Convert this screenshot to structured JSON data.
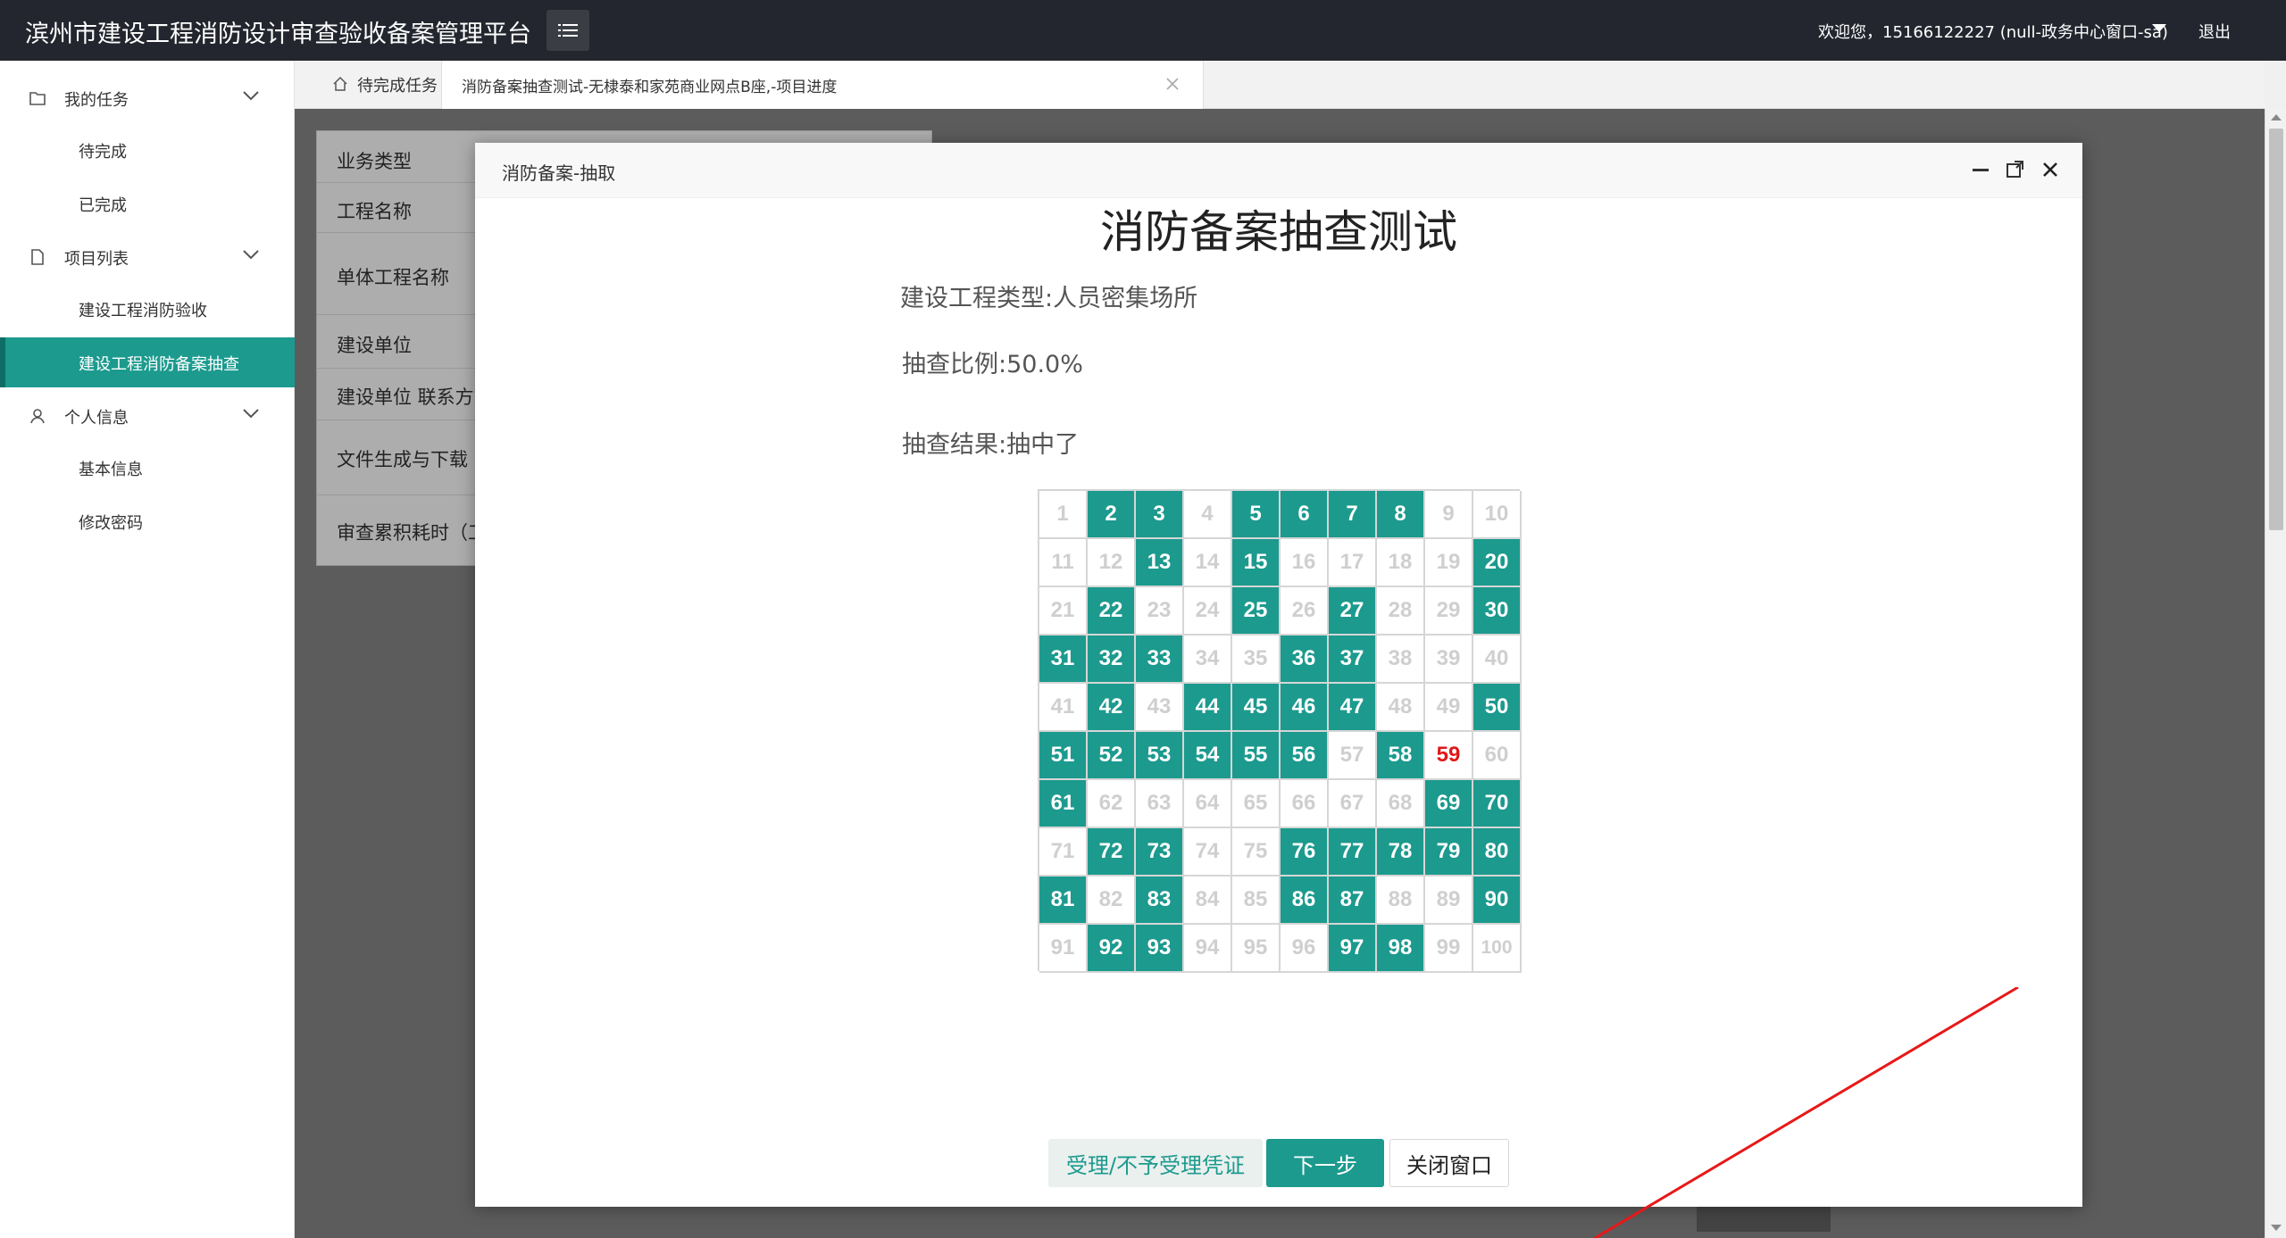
{
  "app": {
    "title": "滨州市建设工程消防设计审查验收备案管理平台",
    "welcome": "欢迎您，15166122227 (null-政务中心窗口-sa)",
    "logout": "退出"
  },
  "sidebar": {
    "groups": [
      {
        "label": "我的任务",
        "items": [
          "待完成",
          "已完成"
        ]
      },
      {
        "label": "项目列表",
        "items": [
          "建设工程消防验收",
          "建设工程消防备案抽查"
        ]
      },
      {
        "label": "个人信息",
        "items": [
          "基本信息",
          "修改密码"
        ]
      }
    ],
    "active_item": "建设工程消防备案抽查"
  },
  "tabs": {
    "home": "待完成任务",
    "current": "消防备案抽查测试-无棣泰和家苑商业网点B座,-项目进度"
  },
  "info_table": {
    "rows": [
      "业务类型",
      "工程名称",
      "单体工程名称",
      "建设单位",
      "建设单位 联系方式",
      "文件生成与下载",
      "审查累积耗时（工"
    ]
  },
  "modal": {
    "title": "消防备案-抽取",
    "doc_title": "消防备案抽查测试",
    "project_type": "建设工程类型:人员密集场所",
    "ratio": "抽查比例:50.0%",
    "result": "抽查结果:抽中了",
    "selected_numbers": [
      2,
      3,
      5,
      6,
      7,
      8,
      13,
      15,
      20,
      22,
      25,
      27,
      30,
      31,
      32,
      33,
      36,
      37,
      42,
      44,
      45,
      46,
      47,
      50,
      51,
      52,
      53,
      54,
      55,
      56,
      58,
      61,
      69,
      70,
      72,
      73,
      76,
      77,
      78,
      79,
      80,
      81,
      83,
      86,
      87,
      90,
      92,
      93,
      97,
      98
    ],
    "hit_number": 59,
    "total": 100,
    "buttons": {
      "voucher": "受理/不予受理凭证",
      "next": "下一步",
      "close": "关闭窗口"
    }
  },
  "colors": {
    "accent": "#1c9a8e",
    "hit": "#e01818",
    "topbar": "#23262e"
  }
}
